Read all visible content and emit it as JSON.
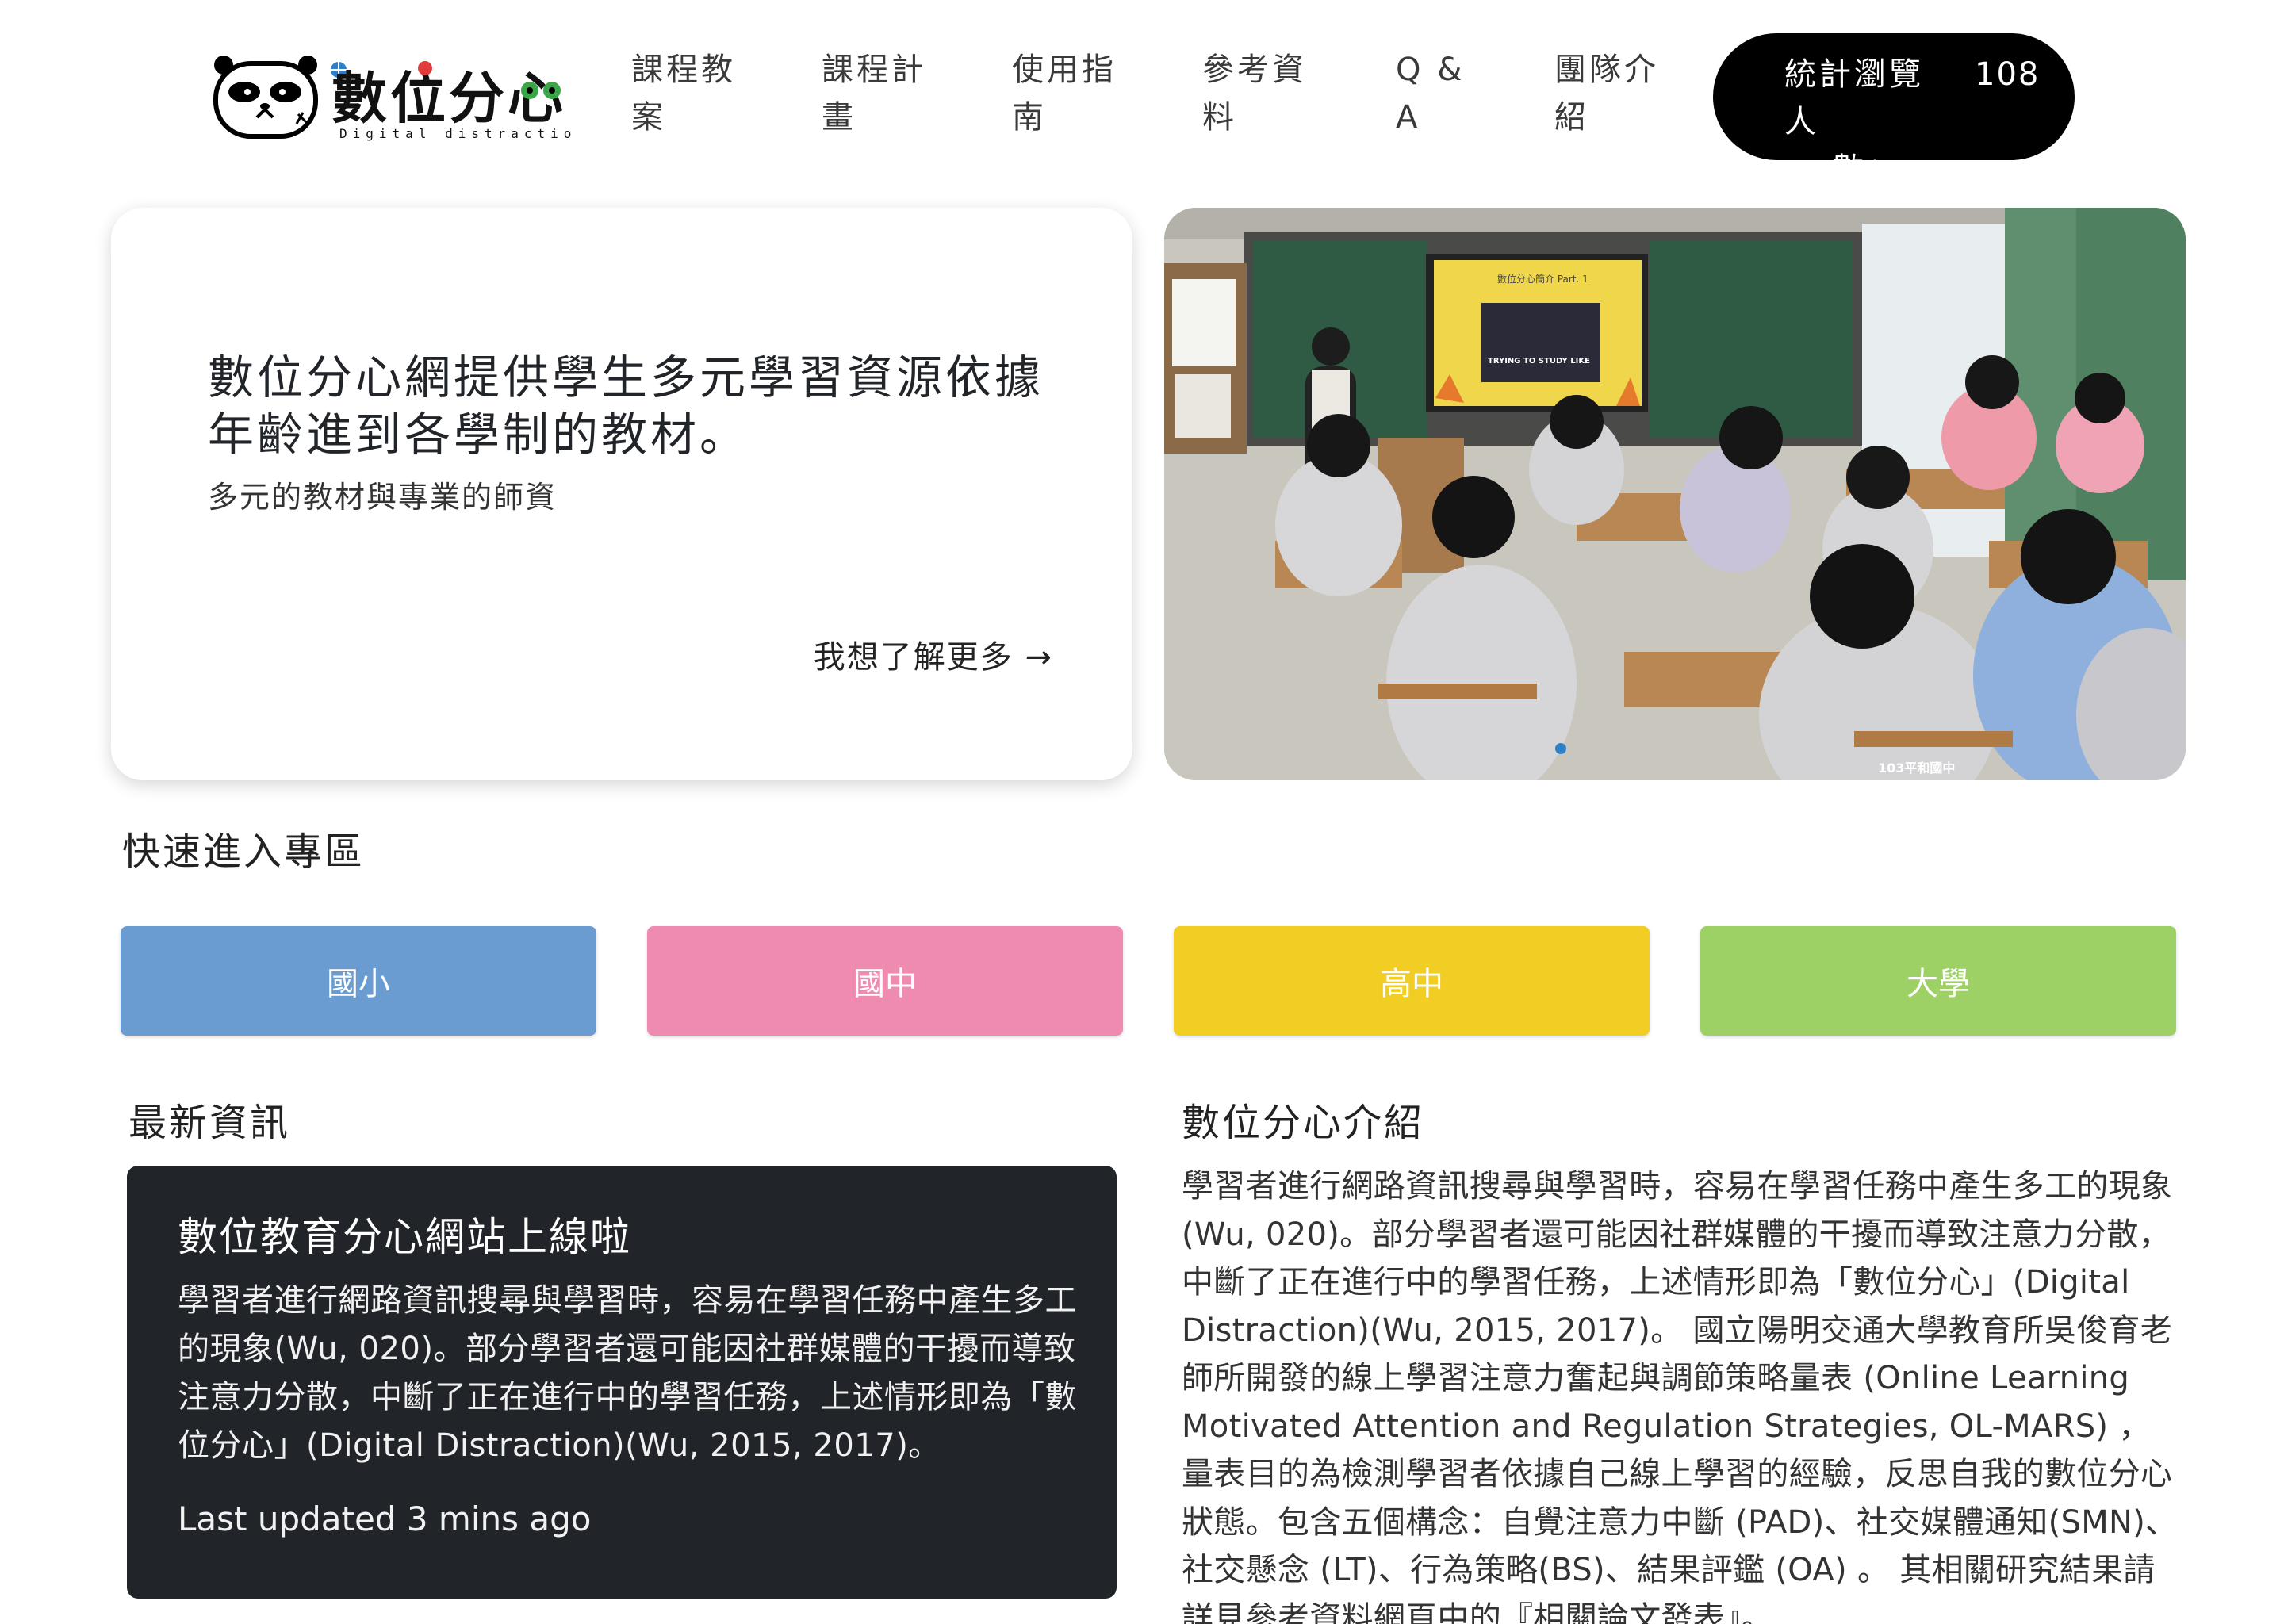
{
  "header": {
    "logo_text": "數位分心",
    "logo_subtext": "Digital distraction",
    "nav": [
      {
        "line1": "課程教",
        "line2": "案"
      },
      {
        "line1": "課程計",
        "line2": "畫"
      },
      {
        "line1": "使用指",
        "line2": "南"
      },
      {
        "line1": "參考資",
        "line2": "料"
      },
      {
        "line1": "Q &",
        "line2": "A"
      },
      {
        "line1": "團隊介",
        "line2": "紹"
      }
    ],
    "stats": {
      "label_line1": "統計瀏覽人",
      "label_line2": "數：",
      "count": "108"
    }
  },
  "hero": {
    "title": "數位分心網提供學生多元學習資源依據年齡進到各學制的教材。",
    "subtitle": "多元的教材與專業的師資",
    "more_link": "我想了解更多 →",
    "photo": {
      "slide_title": "數位分心簡介 Part. 1",
      "slide_caption": "TRYING TO STUDY LIKE",
      "desk_tag": "103平和國中"
    }
  },
  "quick_access": {
    "title": "快速進入專區",
    "buttons": [
      {
        "label": "國小",
        "color": "#6a9bd1"
      },
      {
        "label": "國中",
        "color": "#ef8bb1"
      },
      {
        "label": "高中",
        "color": "#f2cd24"
      },
      {
        "label": "大學",
        "color": "#9dd065"
      }
    ]
  },
  "news": {
    "title": "最新資訊",
    "card_title": "數位教育分心網站上線啦",
    "card_body": "學習者進行網路資訊搜尋與學習時，容易在學習任務中產生多工的現象(Wu, 020)。部分學習者還可能因社群媒體的干擾而導致注意力分散，中斷了正在進行中的學習任務，上述情形即為「數位分心」(Digital Distraction)(Wu, 2015, 2017)。",
    "updated": "Last updated 3 mins ago"
  },
  "intro": {
    "title": "數位分心介紹",
    "body": "學習者進行網路資訊搜尋與學習時，容易在學習任務中產生多工的現象(Wu, 020)。部分學習者還可能因社群媒體的干擾而導致注意力分散，中斷了正在進行中的學習任務，上述情形即為「數位分心」(Digital Distraction)(Wu, 2015, 2017)。 國立陽明交通大學教育所吳俊育老師所開發的線上學習注意力奮起與調節策略量表 (Online Learning Motivated Attention and Regulation Strategies, OL-MARS) ，量表目的為檢測學習者依據自己線上學習的經驗，反思自我的數位分心狀態。包含五個構念：自覺注意力中斷 (PAD)、社交媒體通知(SMN)、社交懸念 (LT)、行為策略(BS)、結果評鑑 (OA) 。 其相關研究結果請詳見參考資料網頁中的『相關論文發表』。"
  }
}
